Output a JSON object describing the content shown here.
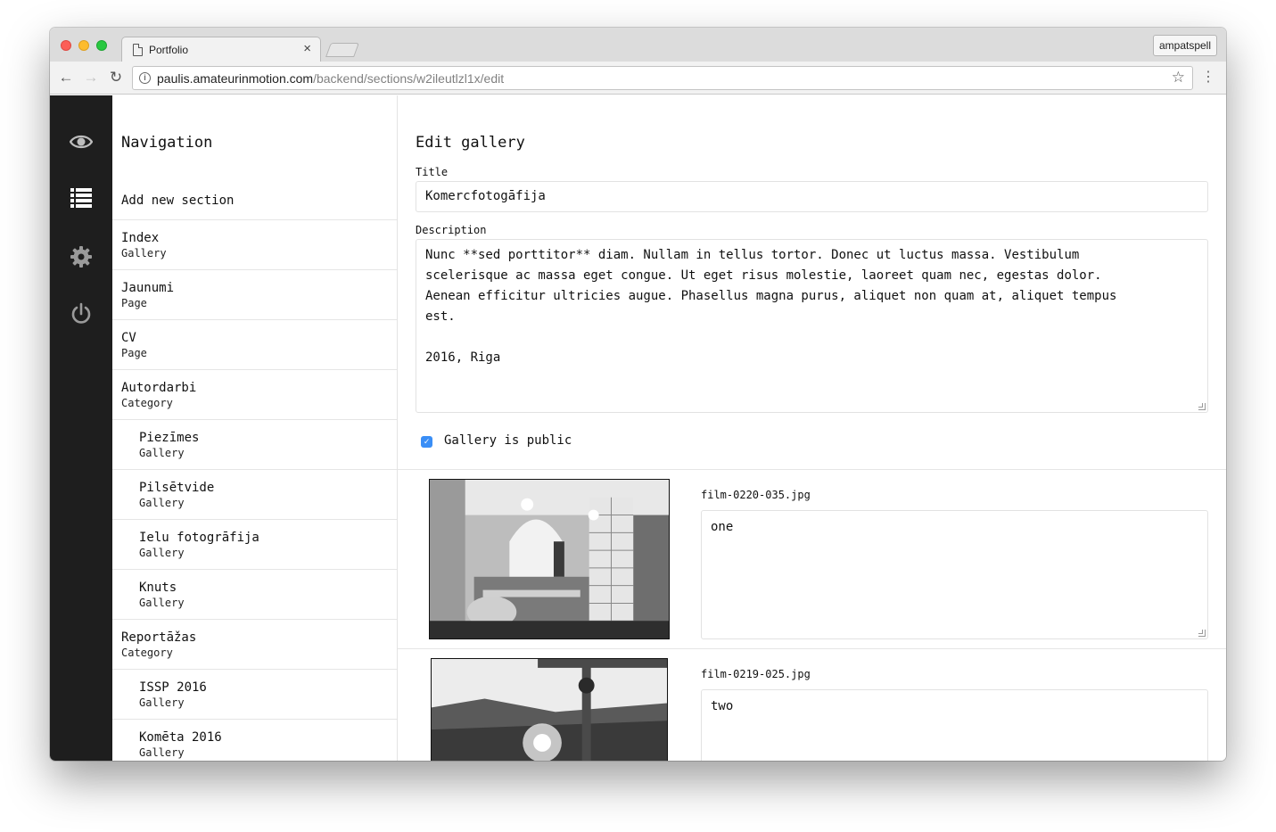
{
  "browser": {
    "tab_title": "Portfolio",
    "tab_close": "×",
    "profile": "ampatspell",
    "url_host": "paulis.amateurinmotion.com",
    "url_path": "/backend/sections/w2ileutlzl1x/edit"
  },
  "nav": {
    "heading": "Navigation",
    "add_section": "Add new section",
    "items": [
      {
        "name": "Index",
        "type": "Gallery"
      },
      {
        "name": "Jaunumi",
        "type": "Page"
      },
      {
        "name": "CV",
        "type": "Page"
      },
      {
        "name": "Autordarbi",
        "type": "Category"
      },
      {
        "name": "Piezīmes",
        "type": "Gallery"
      },
      {
        "name": "Pilsētvide",
        "type": "Gallery"
      },
      {
        "name": "Ielu fotogrāfija",
        "type": "Gallery"
      },
      {
        "name": "Knuts",
        "type": "Gallery"
      },
      {
        "name": "Reportāžas",
        "type": "Category"
      },
      {
        "name": "ISSP 2016",
        "type": "Gallery"
      },
      {
        "name": "Komēta 2016",
        "type": "Gallery"
      }
    ]
  },
  "editor": {
    "heading": "Edit gallery",
    "title_label": "Title",
    "title_value": "Komercfotogāfija",
    "description_label": "Description",
    "description_value": "Nunc **sed porttitor** diam. Nullam in tellus tortor. Donec ut luctus massa. Vestibulum\nscelerisque ac massa eget congue. Ut eget risus molestie, laoreet quam nec, egestas dolor.\nAenean efficitur ultricies augue. Phasellus magna purus, aliquet non quam at, aliquet tempus\nest.\n\n2016, Riga",
    "public_checked": true,
    "public_label": "Gallery is public",
    "images": [
      {
        "filename": "film-0220-035.jpg",
        "caption": "one"
      },
      {
        "filename": "film-0219-025.jpg",
        "caption": "two"
      }
    ]
  }
}
